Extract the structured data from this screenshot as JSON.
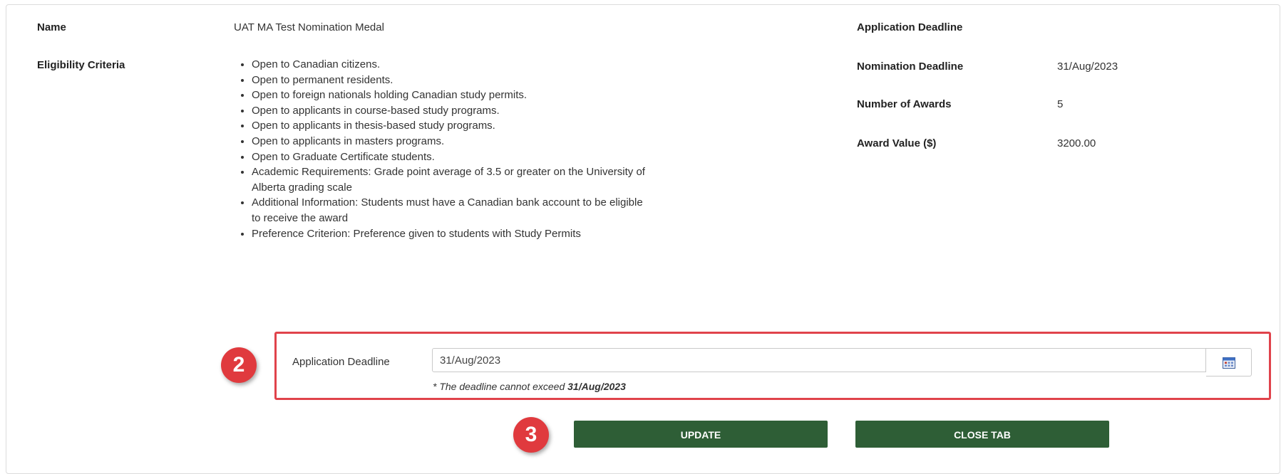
{
  "left": {
    "name_label": "Name",
    "name_value": "UAT MA Test Nomination Medal",
    "eligibility_label": "Eligibility Criteria",
    "criteria": [
      "Open to Canadian citizens.",
      "Open to permanent residents.",
      "Open to foreign nationals holding Canadian study permits.",
      "Open to applicants in course-based study programs.",
      "Open to applicants in thesis-based study programs.",
      "Open to applicants in masters programs.",
      "Open to Graduate Certificate students.",
      "Academic Requirements: Grade point average of 3.5 or greater on the University of Alberta grading scale",
      "Additional Information: Students must have a Canadian bank account to be eligible to receive the award",
      "Preference Criterion: Preference given to students with Study Permits"
    ]
  },
  "right": {
    "application_deadline_label": "Application Deadline",
    "application_deadline_value": "",
    "nomination_deadline_label": "Nomination Deadline",
    "nomination_deadline_value": "31/Aug/2023",
    "number_awards_label": "Number of Awards",
    "number_awards_value": "5",
    "award_value_label": "Award Value ($)",
    "award_value_value": "3200.00"
  },
  "form": {
    "deadline_label": "Application Deadline",
    "deadline_value": "31/Aug/2023",
    "hint_prefix": "* The deadline cannot exceed ",
    "hint_date": "31/Aug/2023",
    "calendar_icon": "calendar-icon"
  },
  "annotations": {
    "badge_2": "2",
    "badge_3": "3"
  },
  "buttons": {
    "update_label": "UPDATE",
    "close_tab_label": "CLOSE TAB"
  },
  "colors": {
    "button_green": "#2e5e36",
    "annotation_red": "#e03a3e"
  }
}
